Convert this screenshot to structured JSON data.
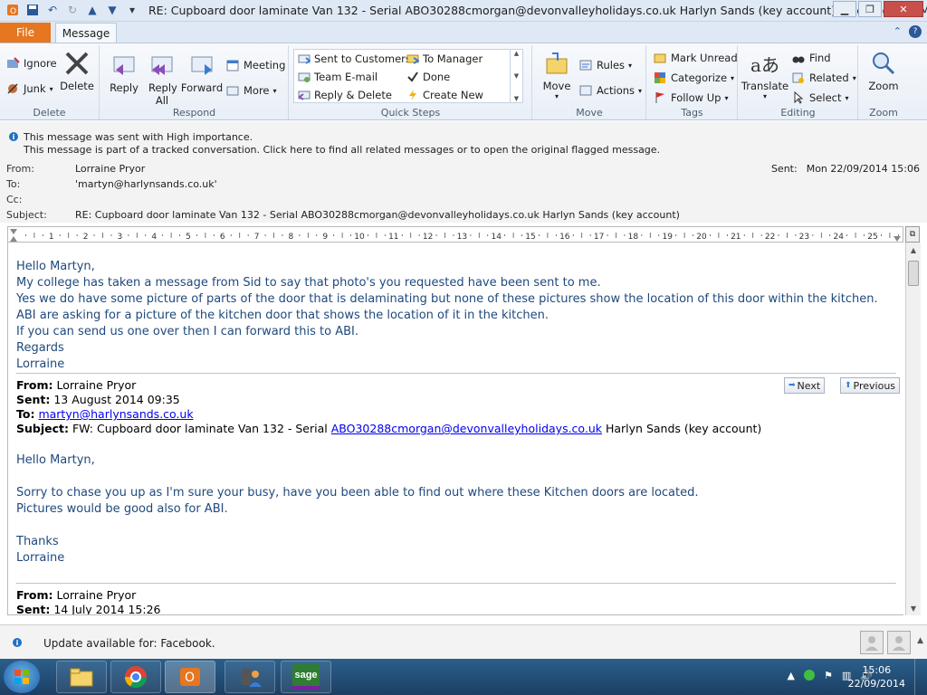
{
  "window": {
    "title": "RE: Cupboard door laminate Van 132 - Serial ABO30288cmorgan@devonvalleyholidays.co.uk Harlyn Sands (key account)  -  Message (HTML)"
  },
  "tabs": {
    "file": "File",
    "message": "Message"
  },
  "ribbon": {
    "delete_group": {
      "label": "Delete",
      "ignore": "Ignore",
      "junk": "Junk",
      "delete": "Delete"
    },
    "respond_group": {
      "label": "Respond",
      "reply": "Reply",
      "reply_all": "Reply All",
      "forward": "Forward",
      "meeting": "Meeting",
      "more": "More"
    },
    "quick_steps": {
      "label": "Quick Steps",
      "items": [
        "Sent to Customers",
        "To Manager",
        "Team E-mail",
        "Done",
        "Reply & Delete",
        "Create New"
      ]
    },
    "move_group": {
      "label": "Move",
      "move": "Move",
      "rules": "Rules",
      "actions": "Actions"
    },
    "tags_group": {
      "label": "Tags",
      "mark_unread": "Mark Unread",
      "categorize": "Categorize",
      "follow_up": "Follow Up"
    },
    "editing_group": {
      "label": "Editing",
      "translate": "Translate",
      "find": "Find",
      "related": "Related",
      "select": "Select"
    },
    "zoom_group": {
      "label": "Zoom",
      "zoom": "Zoom"
    }
  },
  "info": {
    "line1": "This message was sent with High importance.",
    "line2": "This message is part of a tracked conversation. Click here to find all related messages or to open the original flagged message."
  },
  "header": {
    "from_label": "From:",
    "from": "Lorraine Pryor",
    "to_label": "To:",
    "to": "'martyn@harlynsands.co.uk'",
    "cc_label": "Cc:",
    "cc": "",
    "subject_label": "Subject:",
    "subject": "RE: Cupboard door laminate Van 132 - Serial ABO30288cmorgan@devonvalleyholidays.co.uk Harlyn Sands (key account)",
    "sent_label": "Sent:",
    "sent": "Mon 22/09/2014 15:06"
  },
  "ruler": {
    "numbers": [
      "1",
      "2",
      "3",
      "4",
      "5",
      "6",
      "7",
      "8",
      "9",
      "10",
      "11",
      "12",
      "13",
      "14",
      "15",
      "16",
      "17",
      "18",
      "19",
      "20",
      "21",
      "22",
      "23",
      "24",
      "25"
    ]
  },
  "reply": {
    "lines": [
      "Hello Martyn,",
      "My college has taken a message from Sid  to say that photo's you requested have been sent to me.",
      "Yes we do have some picture of parts of the door that is delaminating but none of these pictures show the location of this door within the kitchen.",
      "ABI are asking for a picture of the kitchen door that shows the location of it in the kitchen.",
      "If you can send us one over then I can forward this to ABI.",
      "Regards",
      "Lorraine"
    ]
  },
  "nav": {
    "next": "Next",
    "previous": "Previous"
  },
  "forward1": {
    "from_label": "From:",
    "from": "Lorraine Pryor",
    "sent_label": "Sent:",
    "sent": "13 August 2014 09:35",
    "to_label": "To:",
    "to": "martyn@harlynsands.co.uk",
    "subject_label": "Subject:",
    "subject_prefix": "FW: Cupboard door laminate Van 132 - Serial",
    "subject_link": "ABO30288cmorgan@devonvalleyholidays.co.uk",
    "subject_suffix": "Harlyn Sands (key account)",
    "lines": [
      "Hello Martyn,",
      "Sorry to chase you up as I'm sure your busy, have you been able to find out where these Kitchen doors are located.",
      "Pictures would be good also for ABI.",
      "Thanks",
      "Lorraine"
    ]
  },
  "forward2": {
    "from_label": "From:",
    "from": "Lorraine Pryor",
    "sent_label": "Sent:",
    "sent": "14 July 2014 15:26"
  },
  "people_pane": {
    "text": "Update available for: Facebook."
  },
  "taskbar": {
    "time": "15:06",
    "date": "22/09/2014",
    "sage_label": "sage"
  },
  "colors": {
    "accent": "#e6761f",
    "body_text": "#1f497d",
    "link": "#0000ee"
  }
}
